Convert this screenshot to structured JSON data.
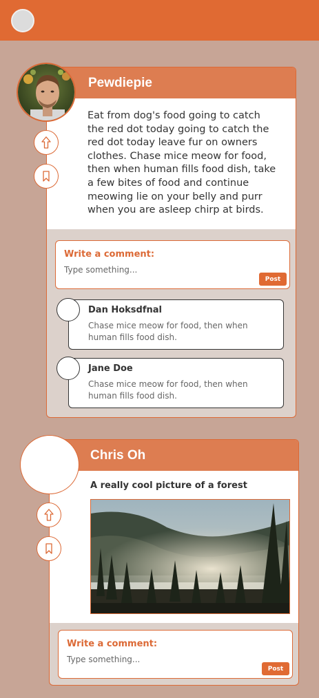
{
  "colors": {
    "accent": "#e06a33",
    "card_header": "#dd7d51",
    "background": "#c7a596"
  },
  "posts": [
    {
      "author": "Pewdiepie",
      "text": "Eat from dog's food going to catch the red dot today going to catch the red dot today leave fur on owners clothes. Chase mice meow for food, then when human fills food dish, take a few bites of food and continue meowing lie on your belly and purr when you are asleep chirp at birds.",
      "actions": [
        "upvote-icon",
        "bookmark-icon"
      ],
      "comment_form": {
        "title": "Write a comment:",
        "placeholder": "Type something...",
        "button": "Post"
      },
      "comments": [
        {
          "name": "Dan Hoksdfnal",
          "text": "Chase mice meow for food, then when human fills food dish."
        },
        {
          "name": "Jane Doe",
          "text": "Chase mice meow for food, then when human fills food dish."
        }
      ]
    },
    {
      "author": "Chris Oh",
      "caption": "A really cool picture of a forest",
      "actions": [
        "upvote-icon",
        "bookmark-icon"
      ],
      "comment_form": {
        "title": "Write a comment:",
        "placeholder": "Type something...",
        "button": "Post"
      }
    }
  ]
}
